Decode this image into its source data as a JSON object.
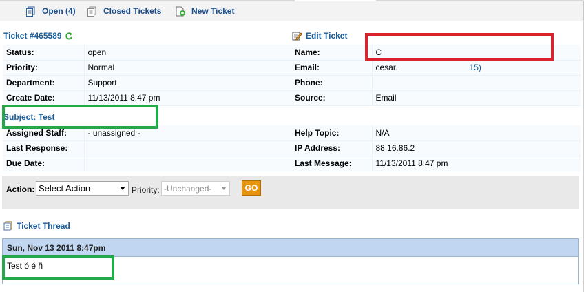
{
  "nav": {
    "items": [
      {
        "label": "Open (4)",
        "icon": "open-tickets-icon"
      },
      {
        "label": "Closed Tickets",
        "icon": "closed-tickets-icon"
      },
      {
        "label": "New Ticket",
        "icon": "new-ticket-icon"
      }
    ]
  },
  "ticket": {
    "title": "Ticket #465589",
    "edit_label": "Edit Ticket",
    "left": [
      {
        "label": "Status:",
        "value": "open"
      },
      {
        "label": "Priority:",
        "value": "Normal"
      },
      {
        "label": "Department:",
        "value": "Support"
      },
      {
        "label": "Create Date:",
        "value": "11/13/2011 8:47 pm"
      }
    ],
    "right": [
      {
        "label": "Name:",
        "value": "C"
      },
      {
        "label": "Email:",
        "value_prefix": "cesar.",
        "value_suffix": "15)"
      },
      {
        "label": "Phone:",
        "value": ""
      },
      {
        "label": "Source:",
        "value": "Email"
      }
    ],
    "subject": "Subject: Test",
    "left2": [
      {
        "label": "Assigned Staff:",
        "value": "- unassigned -"
      },
      {
        "label": "Last Response:",
        "value": ""
      },
      {
        "label": "Due Date:",
        "value": ""
      }
    ],
    "right2": [
      {
        "label": "Help Topic:",
        "value": "N/A"
      },
      {
        "label": "IP Address:",
        "value": "88.16.86.2"
      },
      {
        "label": "Last Message:",
        "value": "11/13/2011 8:47 pm"
      }
    ]
  },
  "actions": {
    "action_label": "Action:",
    "action_value": "Select Action",
    "priority_label": "Priority:",
    "priority_value": "-Unchanged-",
    "go_label": "GO"
  },
  "thread": {
    "link_label": "Ticket Thread",
    "date": "Sun, Nov 13 2011 8:47pm",
    "message": "Test ó é ñ"
  },
  "colors": {
    "link": "#1a5e9a",
    "highlight_red": "#d9232d",
    "highlight_green": "#23a84a",
    "go_button": "#e5950e",
    "thread_header": "#c1d6f1"
  }
}
